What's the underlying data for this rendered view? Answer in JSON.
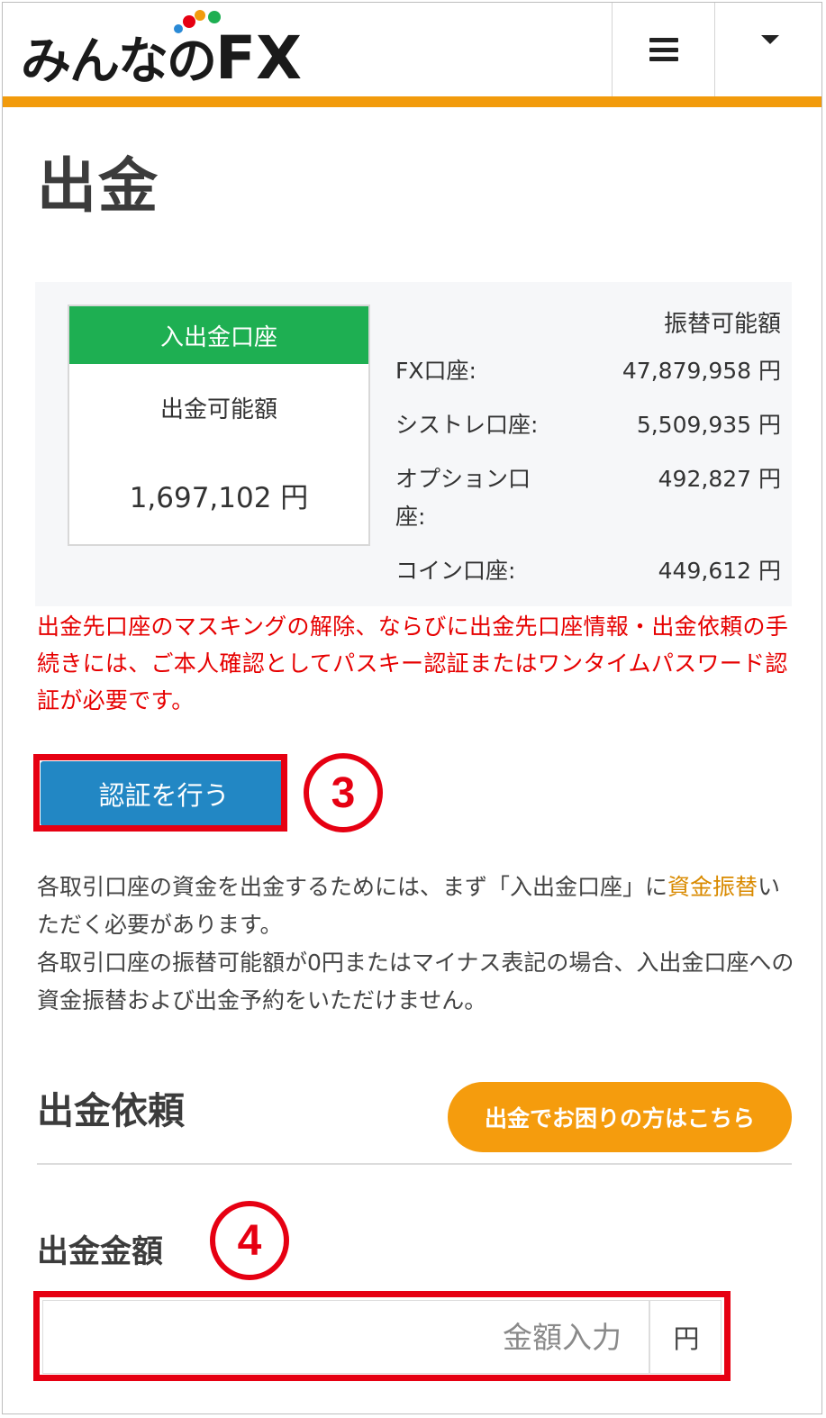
{
  "header": {
    "logo_text_kana": "みんなの",
    "logo_text_fx": "FX",
    "logo_dot_colors": [
      "#e60012",
      "#f29b0c",
      "#1eaf52",
      "#2a8ad6"
    ],
    "accent_color": "#f29b0c",
    "menu_icon": "hamburger-icon",
    "dropdown_icon": "caret-down-icon"
  },
  "page": {
    "title": "出金"
  },
  "balance": {
    "card_header": "入出金口座",
    "card_label": "出金可能額",
    "card_value": "1,697,102 円",
    "column_header": "振替可能額",
    "rows": [
      {
        "label": "FX口座:",
        "value": "47,879,958 円"
      },
      {
        "label": "シストレ口座:",
        "value": "5,509,935 円"
      },
      {
        "label": "オプション口\n座:",
        "value": "492,827 円"
      },
      {
        "label": "コイン口座:",
        "value": "449,612 円"
      }
    ]
  },
  "notice": "出金先口座のマスキングの解除、ならびに出金先口座情報・出金依頼の手続きには、ご本人確認としてパスキー認証またはワンタイムパスワード認証が必要です。",
  "auth": {
    "button_label": "認証を行う",
    "step_number": "3"
  },
  "description": {
    "part1": "各取引口座の資金を出金するためには、まず「入出金口座」に",
    "link": "資金振替",
    "part2": "いただく必要があります。",
    "line2": "各取引口座の振替可能額が0円またはマイナス表記の場合、入出金口座への資金振替および出金予約をいただけません。"
  },
  "withdraw": {
    "section_title": "出金依頼",
    "help_button": "出金でお困りの方はこちら",
    "amount_label": "出金金額",
    "amount_placeholder": "金額入力",
    "amount_unit": "円",
    "step_number": "4"
  }
}
